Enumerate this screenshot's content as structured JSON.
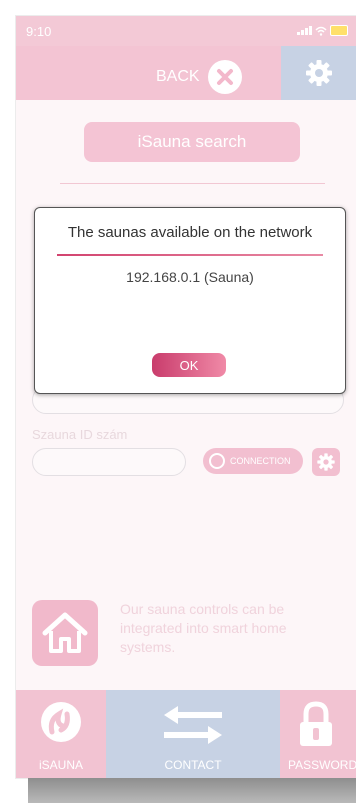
{
  "status_bar": {
    "time": "9:10"
  },
  "header": {
    "back_label": "BACK",
    "icons": [
      "close-icon",
      "gear-icon"
    ]
  },
  "search": {
    "button_label": "iSauna search"
  },
  "form": {
    "id_label": "Szauna ID szám",
    "connect_label": "CONNECTION"
  },
  "promo": {
    "text": "Our sauna controls can be integrated into smart home systems."
  },
  "nav": {
    "items": [
      {
        "label": "iSAUNA",
        "icon": "isauna-logo-icon"
      },
      {
        "label": "CONTACT",
        "icon": "swap-arrows-icon"
      },
      {
        "label": "PASSWORD",
        "icon": "padlock-icon"
      }
    ]
  },
  "dialog": {
    "title": "The saunas available on the network",
    "items": [
      "192.168.0.1 (Sauna)"
    ],
    "ok_label": "OK"
  },
  "colors": {
    "pink": "#f3c4d3",
    "blue": "#c7d2e4",
    "accent": "#d2436f"
  }
}
